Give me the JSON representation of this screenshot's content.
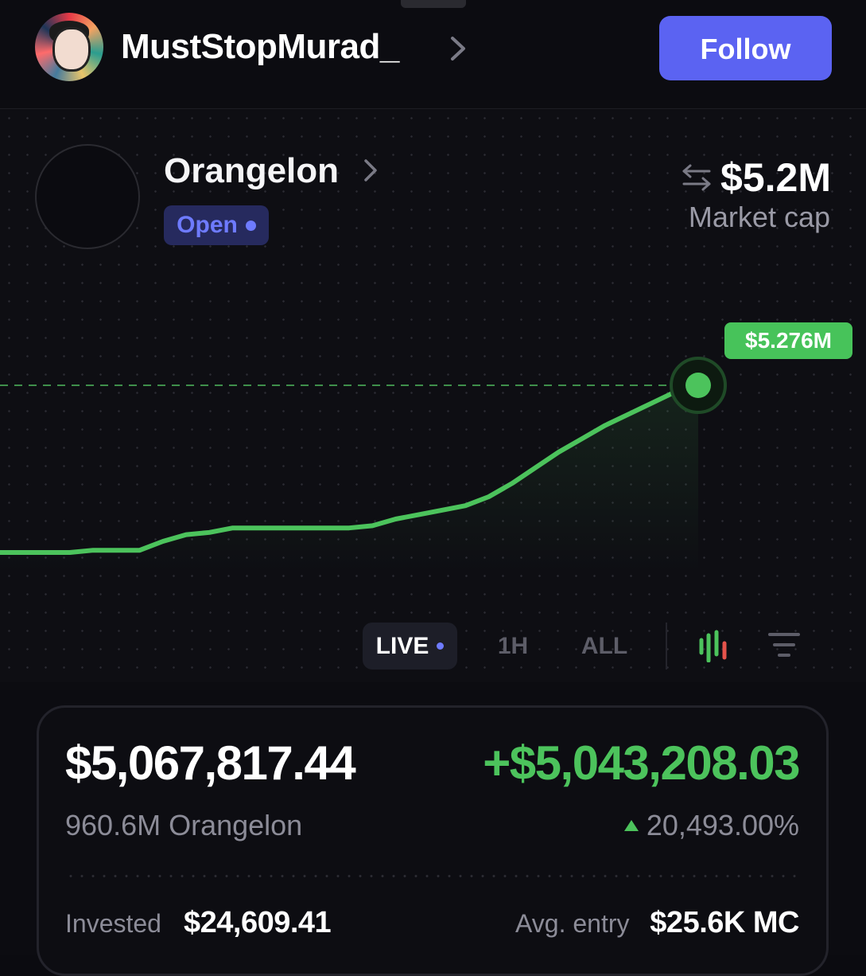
{
  "profile": {
    "username": "MustStopMurad_",
    "follow_label": "Follow"
  },
  "token": {
    "name": "Orangelon",
    "status": "Open",
    "market_cap_value": "$5.2M",
    "market_cap_label": "Market cap",
    "current_price_tag": "$5.276M"
  },
  "chart_controls": {
    "live_label": "LIVE",
    "options": [
      "1H",
      "ALL"
    ],
    "selected": "LIVE"
  },
  "position": {
    "value": "$5,067,817.44",
    "pnl": "+$5,043,208.03",
    "holdings": "960.6M Orangelon",
    "pnl_percent": "20,493.00%",
    "invested_label": "Invested",
    "invested_value": "$24,609.41",
    "avg_entry_label": "Avg. entry",
    "avg_entry_value": "$25.6K MC"
  },
  "colors": {
    "accent": "#5b63f2",
    "positive": "#4cc35c",
    "line": "#4cc35c",
    "badge_bg": "#262a5e",
    "badge_text": "#6e7bff"
  },
  "chart_data": {
    "type": "line",
    "title": "",
    "xlabel": "",
    "ylabel": "",
    "series": [
      {
        "values": [
          0.05,
          0.05,
          0.05,
          0.05,
          0.06,
          0.06,
          0.06,
          0.1,
          0.13,
          0.14,
          0.16,
          0.16,
          0.16,
          0.16,
          0.16,
          0.16,
          0.17,
          0.2,
          0.22,
          0.24,
          0.26,
          0.3,
          0.36,
          0.43,
          0.5,
          0.56,
          0.62,
          0.67,
          0.72,
          0.77,
          0.8
        ]
      }
    ],
    "last_value_label": "$5.276M",
    "grid": false
  }
}
